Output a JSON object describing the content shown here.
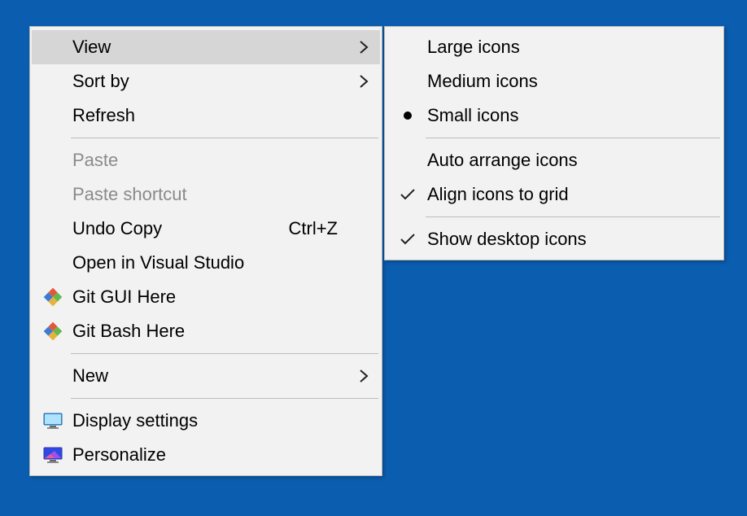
{
  "main_menu": {
    "view": {
      "label": "View"
    },
    "sort_by": {
      "label": "Sort by"
    },
    "refresh": {
      "label": "Refresh"
    },
    "paste": {
      "label": "Paste"
    },
    "paste_shortcut": {
      "label": "Paste shortcut"
    },
    "undo_copy": {
      "label": "Undo Copy",
      "shortcut": "Ctrl+Z"
    },
    "open_vs": {
      "label": "Open in Visual Studio"
    },
    "git_gui": {
      "label": "Git GUI Here"
    },
    "git_bash": {
      "label": "Git Bash Here"
    },
    "new": {
      "label": "New"
    },
    "display_settings": {
      "label": "Display settings"
    },
    "personalize": {
      "label": "Personalize"
    }
  },
  "sub_menu": {
    "large_icons": {
      "label": "Large icons"
    },
    "medium_icons": {
      "label": "Medium icons"
    },
    "small_icons": {
      "label": "Small icons",
      "selected": true
    },
    "auto_arrange": {
      "label": "Auto arrange icons"
    },
    "align_grid": {
      "label": "Align icons to grid",
      "checked": true
    },
    "show_desktop": {
      "label": "Show desktop icons",
      "checked": true
    }
  }
}
